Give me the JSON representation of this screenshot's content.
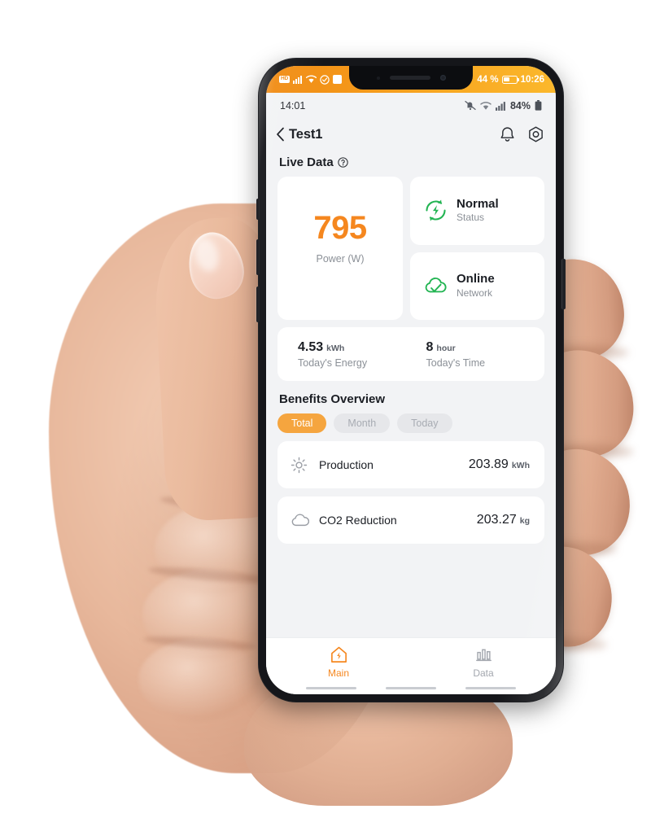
{
  "carrier_bar": {
    "badge_text": "HD",
    "battery_percent": "44 %",
    "clock": "10:26",
    "icons": [
      "volte-badge-icon",
      "signal-bars-icon",
      "wifi-icon",
      "check-circle-icon",
      "sim-card-icon"
    ]
  },
  "status_bar": {
    "time": "14:01",
    "battery_percent": "84%",
    "icons": [
      "notification-off-icon",
      "wifi-icon",
      "signal-bars-icon",
      "battery-icon"
    ]
  },
  "header": {
    "back_icon": "chevron-left-icon",
    "title": "Test1",
    "bell_icon": "bell-icon",
    "settings_icon": "hex-gear-icon"
  },
  "live_data": {
    "section_title": "Live Data",
    "help_icon": "question-circle-icon",
    "power": {
      "value": "795",
      "label": "Power (W)"
    },
    "status_card": {
      "icon": "refresh-bolt-icon",
      "icon_color": "#22b452",
      "value": "Normal",
      "label": "Status"
    },
    "network_card": {
      "icon": "cloud-check-icon",
      "icon_color": "#22b452",
      "value": "Online",
      "label": "Network"
    },
    "today_energy": {
      "number": "4.53",
      "unit": "kWh",
      "label": "Today's Energy"
    },
    "today_time": {
      "number": "8",
      "unit": "hour",
      "label": "Today's Time"
    }
  },
  "benefits": {
    "section_title": "Benefits Overview",
    "tabs": [
      {
        "label": "Total",
        "active": true
      },
      {
        "label": "Month",
        "active": false
      },
      {
        "label": "Today",
        "active": false
      }
    ],
    "rows": [
      {
        "icon": "sun-icon",
        "label": "Production",
        "value": "203.89",
        "unit": "kWh"
      },
      {
        "icon": "cloud-icon",
        "label": "CO2 Reduction",
        "value": "203.27",
        "unit": "kg"
      }
    ]
  },
  "bottom_nav": [
    {
      "label": "Main",
      "icon": "home-bolt-icon",
      "active": true
    },
    {
      "label": "Data",
      "icon": "bar-chart-icon",
      "active": false
    }
  ],
  "colors": {
    "accent_orange": "#f5871f",
    "pill_orange": "#f5a53f",
    "status_green": "#22b452",
    "page_bg": "#f2f3f5",
    "card_bg": "#ffffff",
    "text_primary": "#1b1e24",
    "text_muted": "#8b9097"
  }
}
